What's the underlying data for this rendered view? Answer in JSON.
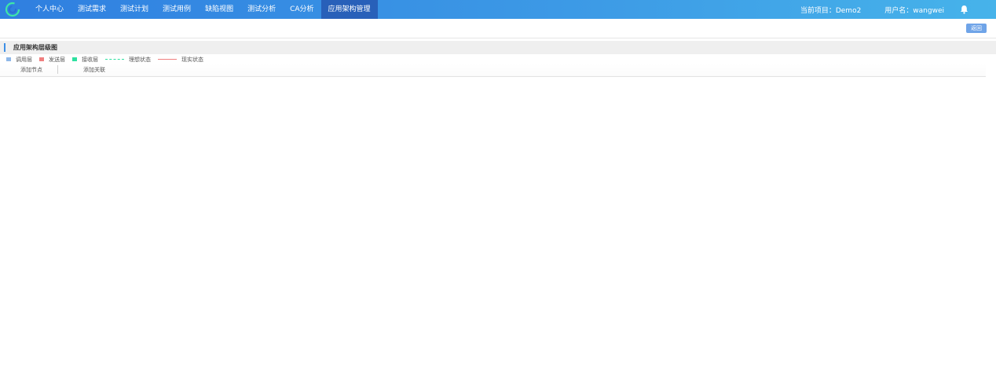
{
  "nav": {
    "items": [
      {
        "label": "个人中心"
      },
      {
        "label": "测试需求"
      },
      {
        "label": "测试计划"
      },
      {
        "label": "测试用例"
      },
      {
        "label": "缺陷视图"
      },
      {
        "label": "测试分析"
      },
      {
        "label": "CA分析"
      },
      {
        "label": "应用架构管理"
      }
    ],
    "active_index": 7,
    "project": "当前项目：Demo2",
    "user": "用户名：wangwei"
  },
  "toolbar": {
    "back_label": "返回"
  },
  "section": {
    "title": "应用架构层级图"
  },
  "legend": {
    "items": [
      {
        "label": "调用层",
        "color": "#8fb8e8",
        "kind": "swatch"
      },
      {
        "label": "发送层",
        "color": "#f07f7f",
        "kind": "swatch"
      },
      {
        "label": "接收层",
        "color": "#2ee0a0",
        "kind": "swatch"
      },
      {
        "label": "理想状态",
        "color": "#2ee0a0",
        "kind": "dashed-line"
      },
      {
        "label": "现实状态",
        "color": "#f07f7f",
        "kind": "solid-line"
      }
    ]
  },
  "canvas_tools": {
    "add_node": "添加节点",
    "add_link": "添加关联"
  },
  "colors": {
    "nav_active": "#2860b9",
    "accent": "#3d8fe6"
  },
  "icons": {
    "logo": "swirl-logo-icon",
    "notification": "bell-icon"
  }
}
